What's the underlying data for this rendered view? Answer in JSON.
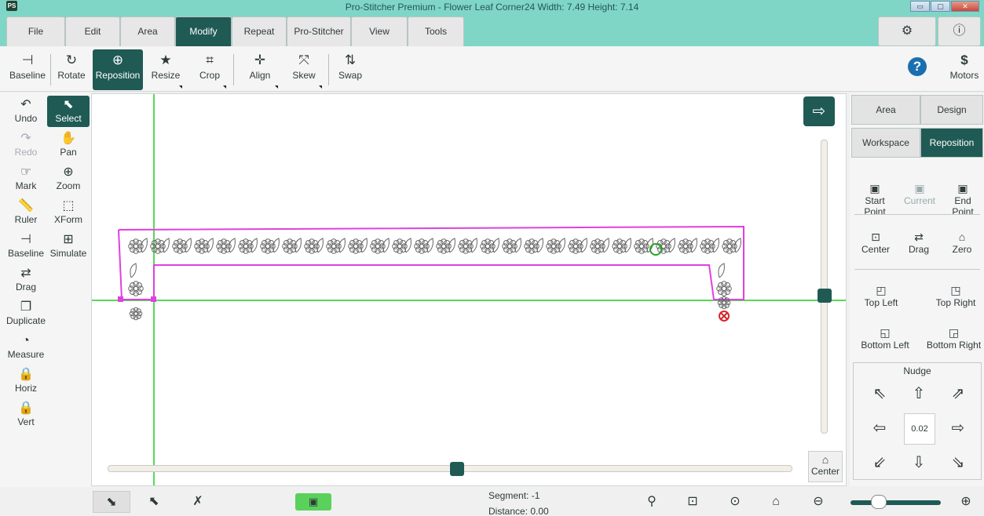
{
  "window": {
    "logo": "PS",
    "title": "Pro-Stitcher Premium  -  Flower Leaf Corner24  Width: 7.49  Height: 7.14",
    "controls": [
      "▭",
      "▢",
      "✕"
    ]
  },
  "menu": {
    "tabs": [
      "File",
      "Edit",
      "Area",
      "Modify",
      "Repeat",
      "Pro-Stitcher",
      "View",
      "Tools"
    ],
    "active": "Modify",
    "settings_icon": "⚙",
    "info_icon": "ⓘ"
  },
  "toolbar": {
    "items": [
      {
        "label": "Baseline",
        "icon": "⊣"
      },
      {
        "label": "Rotate",
        "icon": "↻"
      },
      {
        "label": "Reposition",
        "icon": "⊕"
      },
      {
        "label": "Resize",
        "icon": "★"
      },
      {
        "label": "Crop",
        "icon": "⌗"
      },
      {
        "label": "Align",
        "icon": "✛"
      },
      {
        "label": "Skew",
        "icon": "⤧"
      },
      {
        "label": "Swap",
        "icon": "⇅"
      }
    ],
    "help_icon": "?",
    "motors_label": "Motors",
    "motors_icon": "$"
  },
  "left_tools": [
    {
      "label": "Undo",
      "icon": "↶"
    },
    {
      "label": "Select",
      "icon": "⬉"
    },
    {
      "label": "Redo",
      "icon": "↷"
    },
    {
      "label": "Pan",
      "icon": "✋"
    },
    {
      "label": "Mark",
      "icon": "☞"
    },
    {
      "label": "Zoom",
      "icon": "⊕"
    },
    {
      "label": "Ruler",
      "icon": "📏"
    },
    {
      "label": "XForm",
      "icon": "⬚"
    },
    {
      "label": "Baseline",
      "icon": "⊣"
    },
    {
      "label": "Simulate",
      "icon": "⊞"
    },
    {
      "label": "Drag",
      "icon": "⇄"
    },
    {
      "label": "Duplicate",
      "icon": "❐"
    },
    {
      "label": "Measure",
      "icon": "◔"
    },
    {
      "label": "Horiz",
      "icon": "🔒"
    },
    {
      "label": "Vert",
      "icon": "🔒"
    }
  ],
  "right_panel": {
    "tabs_row1": [
      "Area",
      "Design"
    ],
    "tabs_row2": [
      "Workspace",
      "Reposition"
    ],
    "points": [
      "Start Point",
      "Current",
      "End Point"
    ],
    "row2": [
      "Center",
      "Drag",
      "Zero"
    ],
    "corners": [
      "Top Left",
      "Top Right",
      "Bottom Left",
      "Bottom Right"
    ],
    "nudge": {
      "title": "Nudge",
      "value": "0.02",
      "arrows": [
        "⇖",
        "⇧",
        "⇗",
        "⇦",
        "⇨",
        "⇙",
        "⇩",
        "⇘"
      ]
    }
  },
  "canvas": {
    "center_label": "Center",
    "expand_icon": "⇨"
  },
  "status": {
    "segment_label": "Segment: -1",
    "distance_label": "Distance: 0.00"
  },
  "bottom_bar": {
    "icons": [
      "⬊",
      "⬉",
      "✗",
      "▣",
      "⚲",
      "⊡",
      "⊙",
      "⌂",
      "⊖",
      "⊕"
    ]
  },
  "colors": {
    "accent": "#1f5a55",
    "title_bg": "#7fd6c6",
    "boundary": "#e040e0",
    "guide": "#22cc22"
  }
}
